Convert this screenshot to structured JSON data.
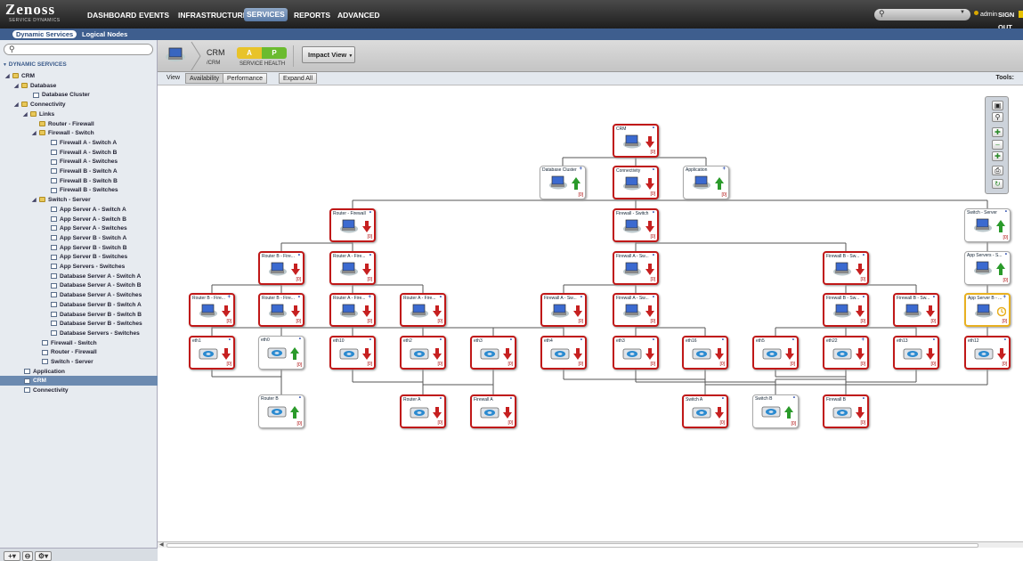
{
  "topbar": {
    "logo_text": "Zenoss",
    "logo_sub": "SERVICE DYNAMICS",
    "nav": [
      "DASHBOARD",
      "EVENTS",
      "INFRASTRUCTURE",
      "SERVICES",
      "REPORTS",
      "ADVANCED"
    ],
    "active_nav": "SERVICES",
    "user": "admin",
    "signout": "SIGN OUT"
  },
  "subnav": {
    "tabs": [
      "Dynamic Services",
      "Logical Nodes"
    ]
  },
  "sidebar": {
    "group_header": "DYNAMIC SERVICES",
    "tree": [
      {
        "label": "CRM",
        "level": 0,
        "icon": "folder",
        "open": true
      },
      {
        "label": "Database",
        "level": 1,
        "icon": "folder",
        "open": true
      },
      {
        "label": "Database Cluster",
        "level": 2,
        "icon": "service"
      },
      {
        "label": "Connectivity",
        "level": 1,
        "icon": "folder",
        "open": true
      },
      {
        "label": "Links",
        "level": 2,
        "icon": "folder",
        "open": true
      },
      {
        "label": "Router - Firewall",
        "level": 3,
        "icon": "folder"
      },
      {
        "label": "Firewall - Switch",
        "level": 3,
        "icon": "folder",
        "open": true
      },
      {
        "label": "Firewall A - Switch A",
        "level": 4,
        "icon": "service"
      },
      {
        "label": "Firewall A - Switch B",
        "level": 4,
        "icon": "service"
      },
      {
        "label": "Firewall A - Switches",
        "level": 4,
        "icon": "service"
      },
      {
        "label": "Firewall B - Switch A",
        "level": 4,
        "icon": "service"
      },
      {
        "label": "Firewall B - Switch B",
        "level": 4,
        "icon": "service"
      },
      {
        "label": "Firewall B - Switches",
        "level": 4,
        "icon": "service"
      },
      {
        "label": "Switch - Server",
        "level": 3,
        "icon": "folder",
        "open": true
      },
      {
        "label": "App Server A - Switch A",
        "level": 4,
        "icon": "service"
      },
      {
        "label": "App Server A - Switch B",
        "level": 4,
        "icon": "service"
      },
      {
        "label": "App Server A - Switches",
        "level": 4,
        "icon": "service"
      },
      {
        "label": "App Server B - Switch A",
        "level": 4,
        "icon": "service"
      },
      {
        "label": "App Server B - Switch B",
        "level": 4,
        "icon": "service"
      },
      {
        "label": "App Server B - Switches",
        "level": 4,
        "icon": "service"
      },
      {
        "label": "App Servers - Switches",
        "level": 4,
        "icon": "service"
      },
      {
        "label": "Database Server A - Switch A",
        "level": 4,
        "icon": "service"
      },
      {
        "label": "Database Server A - Switch B",
        "level": 4,
        "icon": "service"
      },
      {
        "label": "Database Server A - Switches",
        "level": 4,
        "icon": "service"
      },
      {
        "label": "Database Server B - Switch A",
        "level": 4,
        "icon": "service"
      },
      {
        "label": "Database Server B - Switch B",
        "level": 4,
        "icon": "service"
      },
      {
        "label": "Database Server B - Switches",
        "level": 4,
        "icon": "service"
      },
      {
        "label": "Database Servers - Switches",
        "level": 4,
        "icon": "service"
      },
      {
        "label": "Firewall - Switch",
        "level": 3,
        "icon": "service"
      },
      {
        "label": "Router - Firewall",
        "level": 3,
        "icon": "service"
      },
      {
        "label": "Switch - Server",
        "level": 3,
        "icon": "service"
      },
      {
        "label": "Application",
        "level": 1,
        "icon": "service"
      },
      {
        "label": "CRM",
        "level": 1,
        "icon": "service",
        "selected": true
      },
      {
        "label": "Connectivity",
        "level": 1,
        "icon": "service"
      }
    ]
  },
  "header": {
    "service_name": "CRM",
    "service_path": "/CRM",
    "health_a": "A",
    "health_p": "P",
    "health_label": "SERVICE HEALTH",
    "impact_view": "Impact View"
  },
  "viewbar": {
    "view_label": "View",
    "availability": "Availability",
    "performance": "Performance",
    "expand_all": "Expand All",
    "tools_label": "Tools:"
  },
  "graph": {
    "nodes": [
      {
        "id": "crm",
        "name": "CRM",
        "status": "down",
        "kind": "service",
        "cnt": "[0]"
      },
      {
        "id": "dbc",
        "name": "Database Cluster",
        "status": "up",
        "kind": "service",
        "cnt": "[0]",
        "plus": "+"
      },
      {
        "id": "conn",
        "name": "Connectivity",
        "status": "down",
        "kind": "service",
        "cnt": "[0]"
      },
      {
        "id": "app",
        "name": "Application",
        "status": "up",
        "kind": "service",
        "cnt": "[0]",
        "plus": "+"
      },
      {
        "id": "rf",
        "name": "Router - Firewall",
        "status": "down",
        "kind": "service",
        "cnt": "[0]"
      },
      {
        "id": "fs",
        "name": "Firewall - Switch",
        "status": "down",
        "kind": "service",
        "cnt": "[0]"
      },
      {
        "id": "ss",
        "name": "Switch - Server",
        "status": "up",
        "kind": "service",
        "cnt": "[0]"
      },
      {
        "id": "rbf1",
        "name": "Router B - Fire...",
        "status": "down",
        "kind": "service",
        "cnt": "[0]"
      },
      {
        "id": "raf1",
        "name": "Router A - Fire...",
        "status": "down",
        "kind": "service",
        "cnt": "[0]"
      },
      {
        "id": "fas1",
        "name": "Firewall A - Sw...",
        "status": "down",
        "kind": "service",
        "cnt": "[0]"
      },
      {
        "id": "fbs1",
        "name": "Firewall B - Sw...",
        "status": "down",
        "kind": "service",
        "cnt": "[0]"
      },
      {
        "id": "aps",
        "name": "App Servers - S...",
        "status": "up",
        "kind": "service",
        "cnt": "[0]"
      },
      {
        "id": "rbf2",
        "name": "Router B - Fire...",
        "status": "down",
        "kind": "service",
        "cnt": "[0]",
        "plus": "+"
      },
      {
        "id": "rbf3",
        "name": "Router B - Fire...",
        "status": "down",
        "kind": "service",
        "cnt": "[0]"
      },
      {
        "id": "raf2",
        "name": "Router A - Fire...",
        "status": "down",
        "kind": "service",
        "cnt": "[0]",
        "plus": "+"
      },
      {
        "id": "raf3",
        "name": "Router A - Fire...",
        "status": "down",
        "kind": "service",
        "cnt": "[0]"
      },
      {
        "id": "fas2",
        "name": "Firewall A - Sw...",
        "status": "down",
        "kind": "service",
        "cnt": "[0]"
      },
      {
        "id": "fas3",
        "name": "Firewall A - Sw...",
        "status": "down",
        "kind": "service",
        "cnt": "[0]"
      },
      {
        "id": "fbs2",
        "name": "Firewall B - Sw...",
        "status": "down",
        "kind": "service",
        "cnt": "[0]"
      },
      {
        "id": "fbs3",
        "name": "Firewall B - Sw...",
        "status": "down",
        "kind": "service",
        "cnt": "[0]"
      },
      {
        "id": "apb",
        "name": "App Server B - ...",
        "status": "warn",
        "kind": "service",
        "cnt": "[0]",
        "plus": "+"
      },
      {
        "id": "eth1",
        "name": "eth1",
        "status": "down",
        "kind": "device",
        "cnt": "[0]"
      },
      {
        "id": "eth0",
        "name": "eth0",
        "status": "up",
        "kind": "device",
        "cnt": "[0]"
      },
      {
        "id": "eth10",
        "name": "eth10",
        "status": "down",
        "kind": "device",
        "cnt": "[0]"
      },
      {
        "id": "eth2",
        "name": "eth2",
        "status": "down",
        "kind": "device",
        "cnt": "[0]"
      },
      {
        "id": "eth3a",
        "name": "eth3",
        "status": "down",
        "kind": "device",
        "cnt": "[0]"
      },
      {
        "id": "eth4",
        "name": "eth4",
        "status": "down",
        "kind": "device",
        "cnt": "[0]"
      },
      {
        "id": "eth3b",
        "name": "eth3",
        "status": "down",
        "kind": "device",
        "cnt": "[0]"
      },
      {
        "id": "eth16",
        "name": "eth16",
        "status": "down",
        "kind": "device",
        "cnt": "[0]"
      },
      {
        "id": "eth5",
        "name": "eth5",
        "status": "down",
        "kind": "device",
        "cnt": "[0]"
      },
      {
        "id": "eth22",
        "name": "eth22",
        "status": "down",
        "kind": "device",
        "cnt": "[0]",
        "plus": "+"
      },
      {
        "id": "eth13",
        "name": "eth13",
        "status": "down",
        "kind": "device",
        "cnt": "[0]"
      },
      {
        "id": "eth12",
        "name": "eth12",
        "status": "down",
        "kind": "device",
        "cnt": "[0]"
      },
      {
        "id": "routerb",
        "name": "Router B",
        "status": "up",
        "kind": "device",
        "cnt": "[0]"
      },
      {
        "id": "routera",
        "name": "Router A",
        "status": "down",
        "kind": "device",
        "cnt": "[0]"
      },
      {
        "id": "firewalla",
        "name": "Firewall A",
        "status": "down",
        "kind": "device",
        "cnt": "[0]"
      },
      {
        "id": "switcha",
        "name": "Switch A",
        "status": "down",
        "kind": "device",
        "cnt": "[0]"
      },
      {
        "id": "switchb",
        "name": "Switch B",
        "status": "up",
        "kind": "device",
        "cnt": "[0]"
      },
      {
        "id": "firewallb",
        "name": "Firewall B",
        "status": "down",
        "kind": "device",
        "cnt": "[0]"
      }
    ]
  },
  "colors": {
    "down": "#c62020",
    "up": "#2a9a2a",
    "warn": "#e8b020",
    "accent": "#3e5e8e"
  }
}
